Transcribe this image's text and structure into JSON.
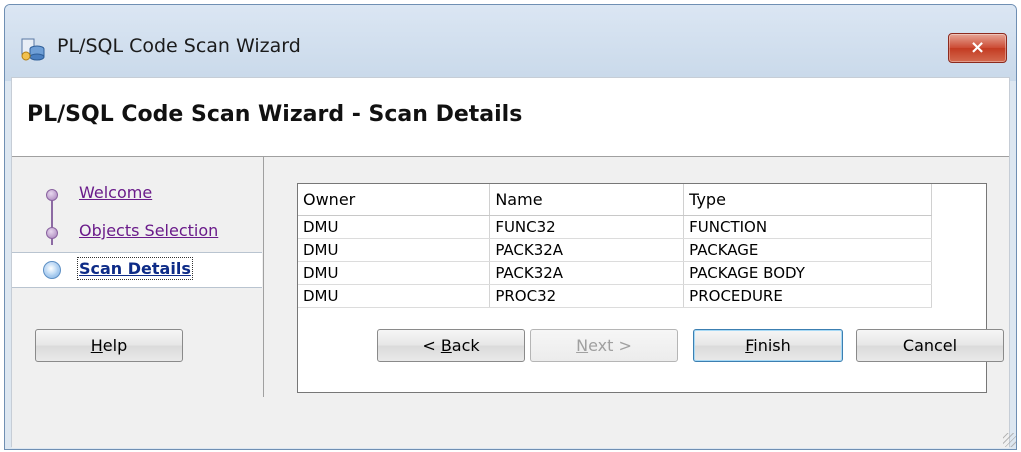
{
  "window": {
    "title": "PL/SQL Code Scan Wizard",
    "close_symbol": "×"
  },
  "header": {
    "title": "PL/SQL Code Scan Wizard - Scan Details"
  },
  "nav": {
    "items": [
      {
        "label": "Welcome",
        "state": "visited"
      },
      {
        "label": "Objects Selection",
        "state": "visited"
      },
      {
        "label": "Scan Details",
        "state": "current"
      }
    ]
  },
  "table": {
    "columns": [
      "Owner",
      "Name",
      "Type"
    ],
    "rows": [
      [
        "DMU",
        "FUNC32",
        "FUNCTION"
      ],
      [
        "DMU",
        "PACK32A",
        "PACKAGE"
      ],
      [
        "DMU",
        "PACK32A",
        "PACKAGE BODY"
      ],
      [
        "DMU",
        "PROC32",
        "PROCEDURE"
      ]
    ]
  },
  "buttons": {
    "help": {
      "mnemonic": "H",
      "rest": "elp"
    },
    "back": {
      "prefix": "< ",
      "mnemonic": "B",
      "rest": "ack"
    },
    "next": {
      "mnemonic": "N",
      "rest": "ext >",
      "disabled": true
    },
    "finish": {
      "mnemonic": "F",
      "rest": "inish"
    },
    "cancel": {
      "label": "Cancel"
    }
  },
  "colors": {
    "title_bg": "#dbe6f3",
    "close_red": "#c33b22",
    "visited_link": "#6a1b8a",
    "current_link": "#0d2b87",
    "panel_bg": "#f0f0f0"
  },
  "icons": {
    "app": "wizard-database-icon",
    "close": "close-icon",
    "resize": "resize-grip-icon"
  }
}
